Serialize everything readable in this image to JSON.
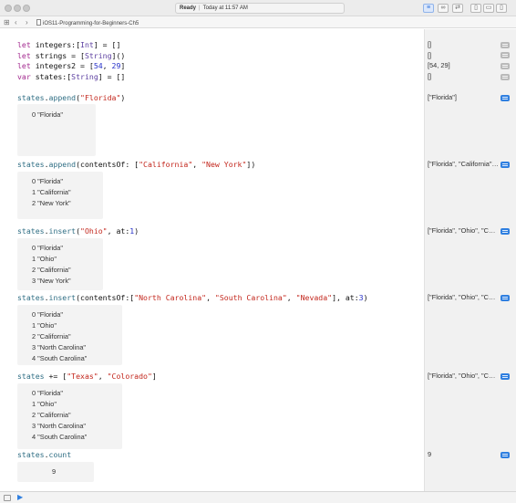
{
  "titlebar": {
    "status": "Ready",
    "timestamp": "Today at 11:57 AM"
  },
  "jumpbar": {
    "back_icon": "chevron-left-icon",
    "forward_icon": "chevron-right-icon",
    "filename": "iOS11-Programming-for-Beginners-Ch5"
  },
  "code_lines": [
    "let integers:[Int] = []",
    "let strings = [String]()",
    "let integers2 = [54, 29]",
    "var states:[String] = []",
    "states.append(\"Florida\")",
    "states.append(contentsOf: [\"California\", \"New York\"])",
    "states.insert(\"Ohio\", at:1)",
    "states.insert(contentsOf:[\"North Carolina\", \"South Carolina\", \"Nevada\"], at:3)",
    "states += [\"Texas\", \"Colorado\"]",
    "states.count"
  ],
  "sidebar_results": [
    "[]",
    "[]",
    "[54, 29]",
    "[]",
    "[\"Florida\"]",
    "[\"Florida\", \"California\", \"New York\"]",
    "[\"Florida\", \"Ohio\", \"California\", \"New York\"]",
    "[\"Florida\", \"Ohio\", \"California\", \"North Carolina\", \"South Carolina\", \"Nevada\", \"New York\"]",
    "[\"Florida\", \"Ohio\", \"California\", \"North Carolina\", \"South Carolina\", \"Nevada\", \"New York\", \"Texas\", \"Colorado\"]",
    "9"
  ],
  "inline_results": {
    "append_one": [
      "0 \"Florida\""
    ],
    "append_contents": [
      "0 \"Florida\"",
      "1 \"California\"",
      "2 \"New York\""
    ],
    "insert_one": [
      "0 \"Florida\"",
      "1 \"Ohio\"",
      "2 \"California\"",
      "3 \"New York\""
    ],
    "insert_contents": [
      "0 \"Florida\"",
      "1 \"Ohio\"",
      "2 \"California\"",
      "3 \"North Carolina\"",
      "4 \"South Carolina\""
    ],
    "plus_equals": [
      "0 \"Florida\"",
      "1 \"Ohio\"",
      "2 \"California\"",
      "3 \"North Carolina\"",
      "4 \"South Carolina\""
    ],
    "count": "9"
  },
  "colors": {
    "keyword": "#a32a8f",
    "type": "#5b3ea0",
    "variable": "#2f6e84",
    "string": "#c3271d",
    "number": "#2530c9",
    "accent": "#2f7fe0"
  },
  "icons": {
    "quicklook": "quick-look-icon",
    "run": "run-triangle-icon"
  }
}
